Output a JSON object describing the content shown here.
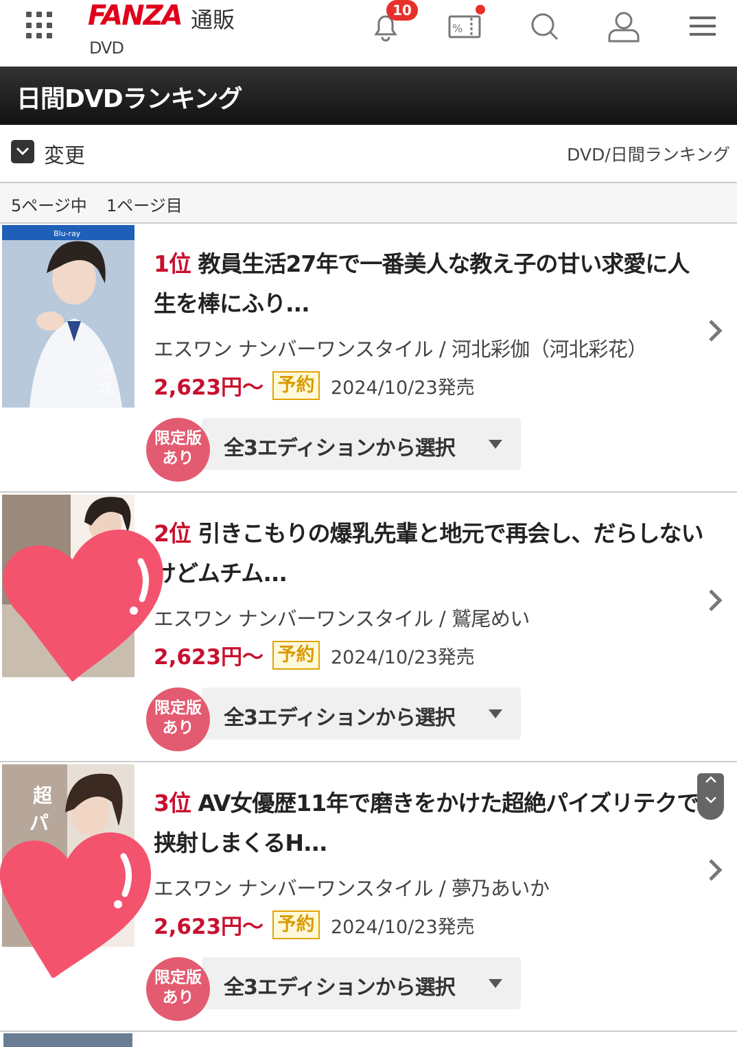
{
  "header": {
    "logo": "FANZA",
    "logo_sub": "通販",
    "section": "DVD",
    "notification_count": "10",
    "icons": [
      "grid-menu-icon",
      "bell-icon",
      "coupon-icon",
      "search-icon",
      "user-icon",
      "hamburger-icon"
    ]
  },
  "page_title": "日間DVDランキング",
  "change_label": "変更",
  "breadcrumb": "DVD/日間ランキング",
  "pagination": {
    "total": "5ページ中",
    "current": "1ページ目"
  },
  "items": [
    {
      "rank": "1位",
      "title": "教員生活27年で一番美人な教え子の甘い求愛に人生を棒にふり...",
      "maker": "エスワン ナンバーワンスタイル / 河北彩伽（河北彩花）",
      "price": "2,623円〜",
      "status": "予約",
      "date": "2024/10/23発売",
      "limited": "限定版あり",
      "edition": "全3エディションから選択"
    },
    {
      "rank": "2位",
      "title": "引きこもりの爆乳先輩と地元で再会し、だらしないけどムチム...",
      "maker": "エスワン ナンバーワンスタイル / 鷲尾めい",
      "price": "2,623円〜",
      "status": "予約",
      "date": "2024/10/23発売",
      "limited": "限定版あり",
      "edition": "全3エディションから選択"
    },
    {
      "rank": "3位",
      "title": "AV女優歴11年で磨きをかけた超絶パイズリテクで挟射しまくるH...",
      "maker": "エスワン ナンバーワンスタイル / 夢乃あいか",
      "price": "2,623円〜",
      "status": "予約",
      "date": "2024/10/23発売",
      "limited": "限定版あり",
      "edition": "全3エディションから選択"
    }
  ],
  "limited_line1": "限定版",
  "limited_line2": "あり",
  "colors": {
    "accent_red": "#c8102e",
    "brand_red": "#e0001b",
    "reserve_yellow": "#e0a400",
    "limited_pink": "#e35b70",
    "heart_pink": "#f4536e"
  }
}
